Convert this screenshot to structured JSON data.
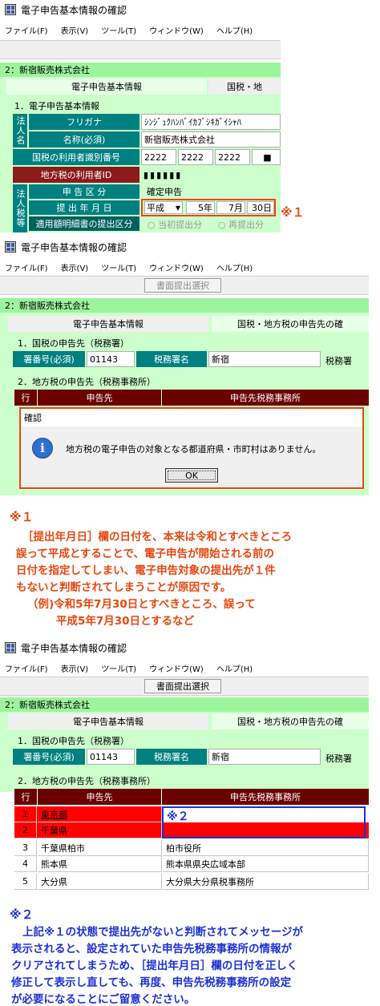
{
  "app": {
    "title": "電子申告基本情報の確認"
  },
  "menu": [
    "ファイル(F)",
    "表示(V)",
    "ツール(T)",
    "ウィンドウ(W)",
    "ヘルプ(H)"
  ],
  "toolbar": {
    "paper_button": "書面提出選択"
  },
  "company": "2：新宿販売株式会社",
  "tabs": {
    "basic": "電子申告基本情報",
    "dest": "国税・地方税の申告先の確",
    "dest_short": "国税・地"
  },
  "panel1": {
    "section": "1．電子申告基本情報",
    "houjinmei_v": "法人名",
    "furigana_label": "フリガナ",
    "furigana_value": "ｼﾝｼﾞｭｸﾊﾝﾊﾞｲｶﾌﾞｼｷｶﾞｲｼｬﾊ",
    "name_label": "名称(必須)",
    "name_value": "新宿販売株式会社",
    "kokuzei_id_label": "国税の利用者識別番号",
    "kokuzei_id": [
      "2222",
      "2222",
      "2222",
      "■"
    ],
    "chihou_id_label": "地方税の利用者ID",
    "chihou_id_value": "▮▮▮▮▮▮",
    "houjinzei_v": "法人税等",
    "kubun_label": "申 告 区 分",
    "kubun_value": "確定申告",
    "date_label": "提 出 年 月 日",
    "era": "平成",
    "year": "5",
    "year_unit": "年",
    "month": "7",
    "month_unit": "月",
    "day": "30",
    "day_unit": "日",
    "tekiyo_label": "適用額明細書の提出区分",
    "radio1": "当初提出分",
    "radio2": "再提出分",
    "marker": "※１"
  },
  "panel2": {
    "sect_kokuzei": "1．国税の申告先（税務署）",
    "shobango_label": "署番号(必須)",
    "shobango": "01143",
    "zeimusho_label": "税務署名",
    "zeimusho": "新宿",
    "zeimusho_suffix": "税務署",
    "sect_chihou": "2．地方税の申告先（税務事務所）",
    "col_gyo": "行",
    "col_dest": "申告先",
    "col_office": "申告先税務事務所",
    "dialog_title": "確認",
    "dialog_msg": "地方税の電子申告の対象となる都道府県・市町村はありません。",
    "ok": "OK"
  },
  "note1": {
    "mark": "※１",
    "lines": [
      "［提出年月日］欄の日付を、本来は令和とすべきところ",
      "誤って平成とすることで、電子申告が開始される前の",
      "日付を指定してしまい、電子申告対象の提出先が１件",
      "もないと判断されてしまうことが原因です。",
      "（例)令和5年7月30日とすべきところ、誤って",
      "平成5年7月30日とするなど"
    ]
  },
  "panel3": {
    "marker": "※２",
    "rows": [
      {
        "no": "1",
        "dest": "東京都",
        "office": ""
      },
      {
        "no": "2",
        "dest": "千葉県",
        "office": ""
      },
      {
        "no": "3",
        "dest": "千葉県柏市",
        "office": "柏市役所"
      },
      {
        "no": "4",
        "dest": "熊本県",
        "office": "熊本県県央広域本部"
      },
      {
        "no": "5",
        "dest": "大分県",
        "office": "大分県大分県税事務所"
      }
    ]
  },
  "note2": {
    "mark": "※２",
    "lines": [
      "上記※１の状態で提出先がないと判断されてメッセージが",
      "表示されると、設定されていた申告先税務事務所の情報が",
      "クリアされてしまうため、［提出年月日］欄の日付を正しく",
      "修正して表示し直しても、再度、申告先税務事務所の設定",
      "が必要になることにご留意ください。"
    ]
  },
  "colors": {
    "orange": "#e8470f",
    "blue": "#1c31d6",
    "red": "#ff0000",
    "green": "#9cf59c",
    "teal": "#008080"
  }
}
